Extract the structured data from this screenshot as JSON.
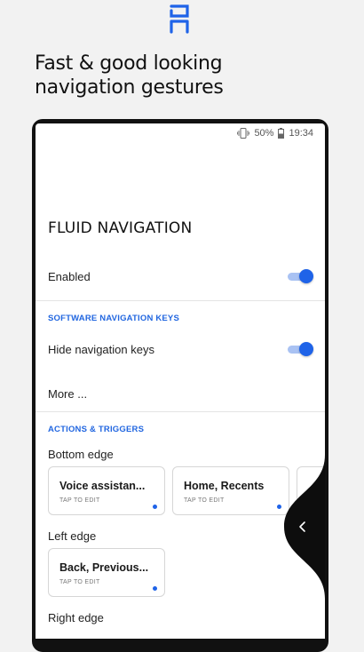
{
  "header": {
    "headline_line1": "Fast & good looking",
    "headline_line2": "navigation gestures",
    "logo_icon": "fluid-ng-logo-icon"
  },
  "colors": {
    "accent": "#1f63e8",
    "accent_track": "#a9c2f3",
    "section_header": "#2166e0",
    "background": "#f2f2f2",
    "phone_frame": "#111111"
  },
  "status_bar": {
    "vibrate_icon": "vibrate-icon",
    "battery_percent": "50%",
    "battery_icon": "battery-icon",
    "time": "19:34"
  },
  "app": {
    "title": "FLUID NAVIGATION",
    "enabled": {
      "label": "Enabled",
      "on": true
    },
    "software_keys": {
      "header": "SOFTWARE NAVIGATION KEYS",
      "hide_keys": {
        "label": "Hide navigation keys",
        "on": true
      },
      "more_label": "More ..."
    },
    "actions": {
      "header": "ACTIONS & TRIGGERS",
      "bottom_edge": {
        "label": "Bottom edge",
        "cards": [
          {
            "title": "Voice assistan...",
            "sub": "TAP TO EDIT"
          },
          {
            "title": "Home, Recents",
            "sub": "TAP TO EDIT"
          }
        ]
      },
      "left_edge": {
        "label": "Left edge",
        "cards": [
          {
            "title": "Back, Previous...",
            "sub": "TAP TO EDIT"
          }
        ]
      },
      "right_edge": {
        "label": "Right edge"
      }
    },
    "edge_handle_icon": "chevron-left-icon"
  }
}
